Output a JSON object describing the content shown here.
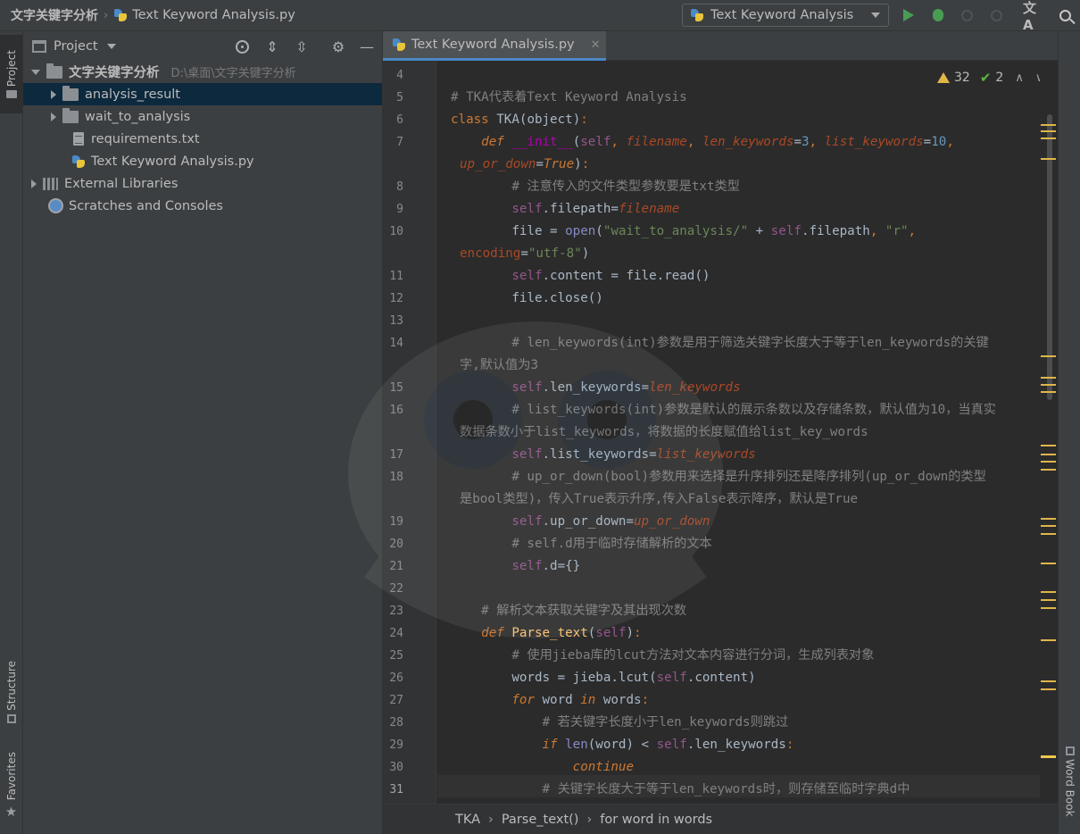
{
  "titlebar": {
    "project_name": "文字关键字分析",
    "file_name": "Text Keyword Analysis.py",
    "run_config": "Text Keyword Analysis",
    "translate_glyph": "文A"
  },
  "left_strip": {
    "project_tab": "Project",
    "structure_tab": "Structure",
    "favorites_tab": "Favorites"
  },
  "right_strip": {
    "word_book_tab": "Word Book"
  },
  "project_panel": {
    "title": "Project",
    "tree": [
      {
        "label": "文字关键字分析",
        "hint": "D:\\桌面\\文字关键字分析"
      },
      {
        "label": "analysis_result"
      },
      {
        "label": "wait_to_analysis"
      },
      {
        "label": "requirements.txt"
      },
      {
        "label": "Text Keyword Analysis.py"
      },
      {
        "label": "External Libraries"
      },
      {
        "label": "Scratches and Consoles"
      }
    ]
  },
  "editor": {
    "tab_label": "Text Keyword Analysis.py",
    "warnings_count": "32",
    "weak_warnings_count": "2",
    "line_numbers": [
      "4",
      "5",
      "6",
      "7",
      "8",
      "9",
      "10",
      "11",
      "12",
      "13",
      "14",
      "15",
      "16",
      "17",
      "18",
      "19",
      "20",
      "21",
      "22",
      "23",
      "24",
      "25",
      "26",
      "27",
      "28",
      "29",
      "30",
      "31"
    ],
    "code": {
      "c5": "# TKA代表着Text Keyword Analysis",
      "c8": "# 注意传入的文件类型参数要是txt类型",
      "c14a": "# len_keywords(int)参数是用于筛选关键字长度大于等于len_keywords的关键",
      "c14b": "字,默认值为3",
      "c16a": "# list_keywords(int)参数是默认的展示条数以及存储条数，默认值为10，当真实",
      "c16b": "数据条数小于list_keywords，将数据的长度赋值给list_key_words",
      "c18a": "# up_or_down(bool)参数用来选择是升序排列还是降序排列(up_or_down的类型",
      "c18b": "是bool类型)，传入True表示升序,传入False表示降序，默认是True",
      "c20": "# self.d用于临时存储解析的文本",
      "c23": "# 解析文本获取关键字及其出现次数",
      "c25": "# 使用jieba库的lcut方法对文本内容进行分词，生成列表对象",
      "c28": "# 若关键字长度小于len_keywords则跳过",
      "c31": "# 关键字长度大于等于len_keywords时，则存储至临时字典d中"
    }
  },
  "breadcrumbs": [
    "TKA",
    "Parse_text()",
    "for word in words"
  ],
  "colors": {
    "accent": "#4a88c7",
    "run_green": "#499c54",
    "warning": "#e0b649",
    "keyword": "#cc7832",
    "function": "#ffc66d",
    "self": "#94558d",
    "string": "#6a8759",
    "number": "#6897bb",
    "comment": "#808080"
  }
}
